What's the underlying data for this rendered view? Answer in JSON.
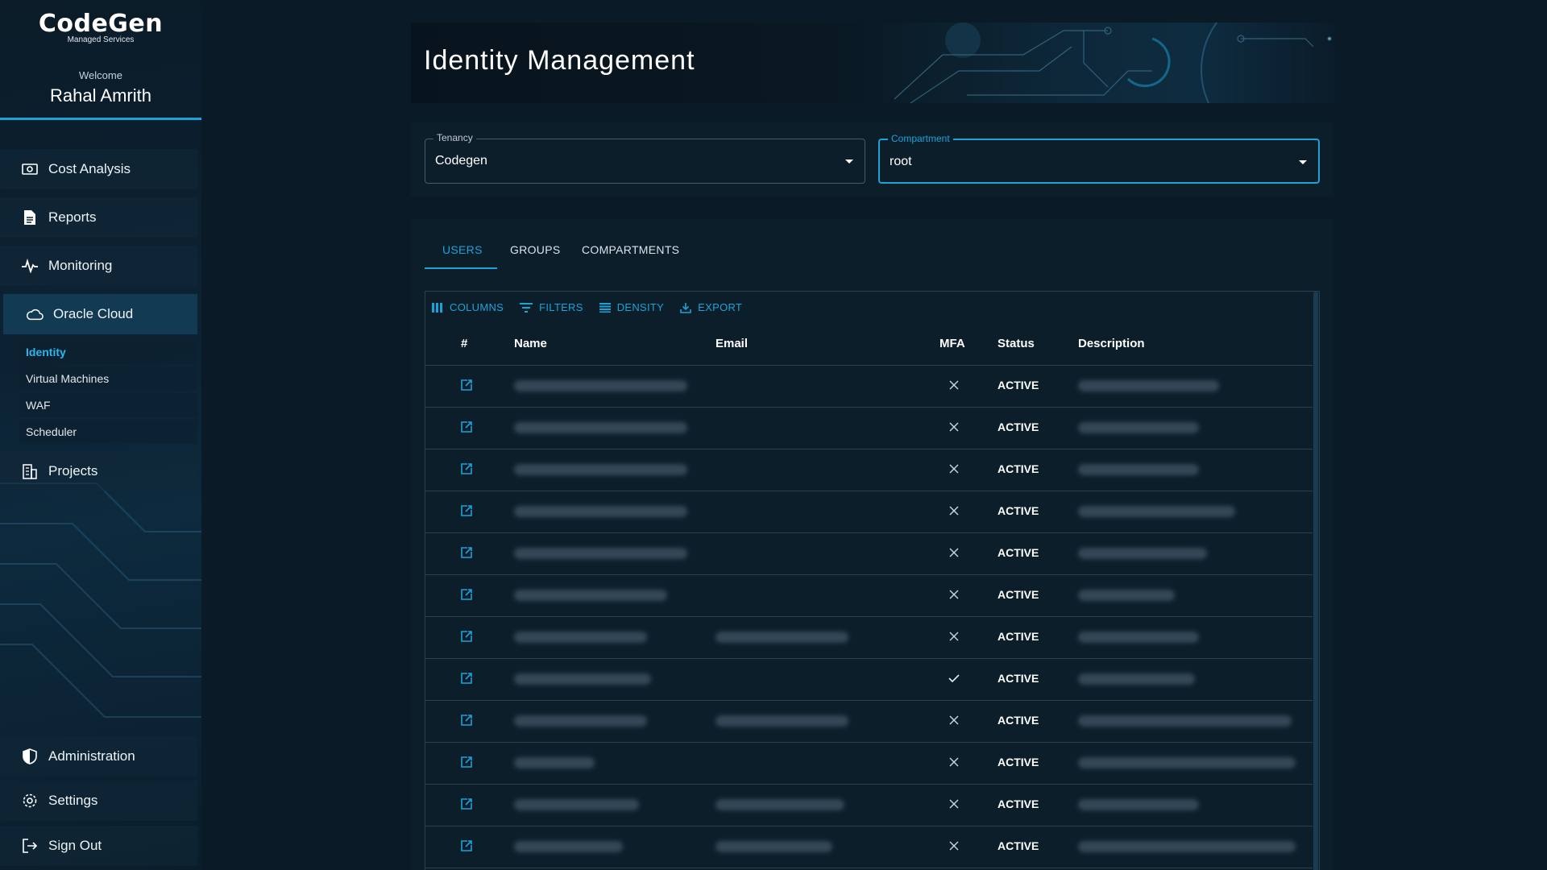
{
  "brand": {
    "name": "CodeGen",
    "subtitle": "Managed Services"
  },
  "user": {
    "welcome": "Welcome",
    "name": "Rahal Amrith"
  },
  "nav": {
    "cost_analysis": "Cost Analysis",
    "reports": "Reports",
    "monitoring": "Monitoring",
    "oracle_cloud": "Oracle Cloud",
    "sub": [
      "Identity",
      "Virtual Machines",
      "WAF",
      "Scheduler"
    ],
    "projects": "Projects",
    "administration": "Administration",
    "settings": "Settings",
    "sign_out": "Sign Out"
  },
  "page": {
    "title": "Identity Management"
  },
  "tenancy": {
    "label": "Tenancy",
    "value": "Codegen"
  },
  "compartment": {
    "label": "Compartment",
    "value": "root"
  },
  "tabs": [
    "USERS",
    "GROUPS",
    "COMPARTMENTS"
  ],
  "toolbar": {
    "columns": "COLUMNS",
    "filters": "FILTERS",
    "density": "DENSITY",
    "export": "EXPORT"
  },
  "columns": {
    "index": "#",
    "name": "Name",
    "email": "Email",
    "mfa": "MFA",
    "status": "Status",
    "description": "Description"
  },
  "rows": [
    {
      "mfa": false,
      "status": "ACTIVE"
    },
    {
      "mfa": false,
      "status": "ACTIVE"
    },
    {
      "mfa": false,
      "status": "ACTIVE"
    },
    {
      "mfa": false,
      "status": "ACTIVE"
    },
    {
      "mfa": false,
      "status": "ACTIVE"
    },
    {
      "mfa": false,
      "status": "ACTIVE"
    },
    {
      "mfa": false,
      "status": "ACTIVE"
    },
    {
      "mfa": true,
      "status": "ACTIVE"
    },
    {
      "mfa": false,
      "status": "ACTIVE"
    },
    {
      "mfa": false,
      "status": "ACTIVE"
    },
    {
      "mfa": false,
      "status": "ACTIVE"
    },
    {
      "mfa": false,
      "status": "ACTIVE"
    }
  ],
  "colors": {
    "accent": "#1aa3d9",
    "background": "#0a1a26"
  }
}
